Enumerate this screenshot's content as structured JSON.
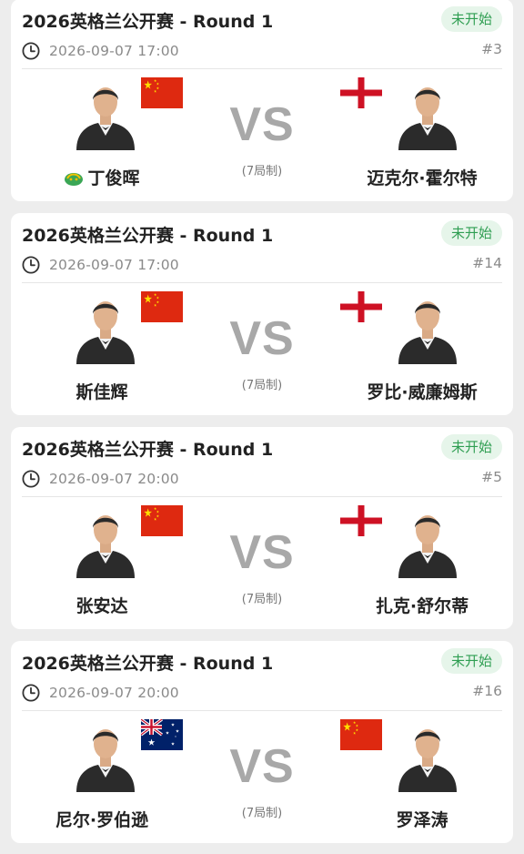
{
  "colors": {
    "background": "#ededed",
    "card": "#ffffff",
    "status_bg": "#e6f5ea",
    "status_text": "#2f9e52",
    "vs_text": "#a8a8a8"
  },
  "matches": [
    {
      "title": "2026英格兰公开赛 - Round 1",
      "status": "未开始",
      "time": "2026-09-07 17:00",
      "match_no": "#3",
      "vs": "VS",
      "format": "(7局制)",
      "left_player": {
        "name": "丁俊晖",
        "flag_icon": "china-flag-icon",
        "has_badge": true,
        "badge_icon": "dragon-badge-icon"
      },
      "right_player": {
        "name": "迈克尔·霍尔特",
        "flag_icon": "england-flag-icon"
      }
    },
    {
      "title": "2026英格兰公开赛 - Round 1",
      "status": "未开始",
      "time": "2026-09-07 17:00",
      "match_no": "#14",
      "vs": "VS",
      "format": "(7局制)",
      "left_player": {
        "name": "斯佳辉",
        "flag_icon": "china-flag-icon"
      },
      "right_player": {
        "name": "罗比·威廉姆斯",
        "flag_icon": "england-flag-icon"
      }
    },
    {
      "title": "2026英格兰公开赛 - Round 1",
      "status": "未开始",
      "time": "2026-09-07 20:00",
      "match_no": "#5",
      "vs": "VS",
      "format": "(7局制)",
      "left_player": {
        "name": "张安达",
        "flag_icon": "china-flag-icon"
      },
      "right_player": {
        "name": "扎克·舒尔蒂",
        "flag_icon": "england-flag-icon"
      }
    },
    {
      "title": "2026英格兰公开赛 - Round 1",
      "status": "未开始",
      "time": "2026-09-07 20:00",
      "match_no": "#16",
      "vs": "VS",
      "format": "(7局制)",
      "left_player": {
        "name": "尼尔·罗伯逊",
        "flag_icon": "australia-flag-icon"
      },
      "right_player": {
        "name": "罗泽涛",
        "flag_icon": "china-flag-icon"
      }
    }
  ]
}
